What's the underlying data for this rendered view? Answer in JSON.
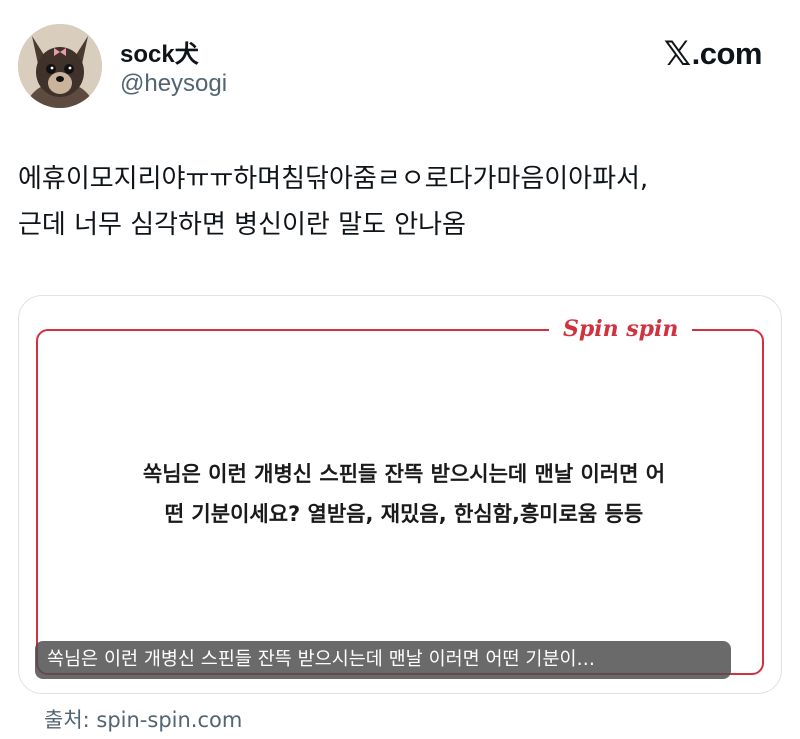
{
  "author": {
    "name": "sock犬",
    "handle": "@heysogi"
  },
  "brand": {
    "logo_text": ".com"
  },
  "tweet": {
    "text": "에휴이모지리야ㅠㅠ하며침닦아줌ㄹㅇ로다가마음이아파서,\n근데 너무 심각하면 병신이란 말도 안나옴"
  },
  "card": {
    "brand_label": "Spin spin",
    "question": "쏙님은 이런 개병신 스핀들 잔뜩 받으시는데 맨날 이러면 어\n떤 기분이세요? 열받음, 재밌음, 한심함,흥미로움 등등",
    "caption": "쏙님은 이런 개병신 스핀들 잔뜩 받으시는데 맨날 이러면 어떤 기분이…",
    "accent_color": "#d2313f"
  },
  "source": {
    "label": "출처: spin-spin.com"
  }
}
